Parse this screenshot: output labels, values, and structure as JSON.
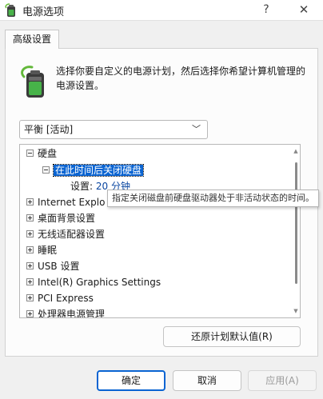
{
  "window": {
    "title": "电源选项",
    "help_label": "?",
    "close_label": "✕"
  },
  "tab": {
    "label": "高级设置"
  },
  "description": "选择你要自定义的电源计划，然后选择你希望计算机管理的电源设置。",
  "plan_select": {
    "value": "平衡 [活动]"
  },
  "tree": {
    "items": [
      {
        "label": "硬盘",
        "expanded": true
      },
      {
        "label": "在此时间后关闭硬盘",
        "expanded": true,
        "selected": true
      },
      {
        "label": "设置:",
        "value": "20 分钟"
      },
      {
        "label": "Internet Explo",
        "expanded": false
      },
      {
        "label": "桌面背景设置",
        "expanded": false
      },
      {
        "label": "无线适配器设置",
        "expanded": false
      },
      {
        "label": "睡眠",
        "expanded": false
      },
      {
        "label": "USB 设置",
        "expanded": false
      },
      {
        "label": "Intel(R) Graphics Settings",
        "expanded": false
      },
      {
        "label": "PCI Express",
        "expanded": false
      },
      {
        "label": "处理器电源管理",
        "expanded": false
      }
    ]
  },
  "tooltip": "指定关闭磁盘前硬盘驱动器处于非活动状态的时间。",
  "buttons": {
    "restore": "还原计划默认值(R)",
    "ok": "确定",
    "cancel": "取消",
    "apply": "应用(A)"
  },
  "colors": {
    "accent": "#0a64d2",
    "setting_value": "#0a46a0"
  }
}
